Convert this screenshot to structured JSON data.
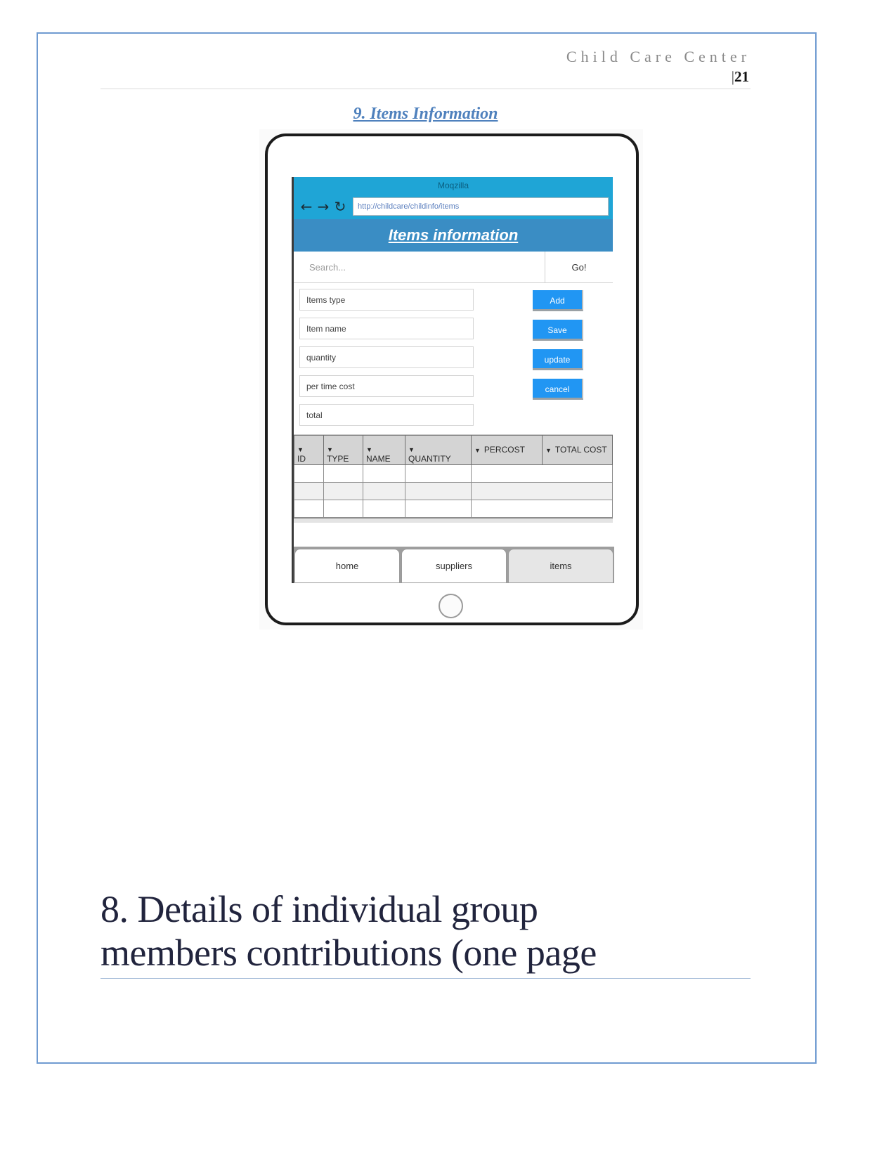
{
  "document": {
    "header_title": "Child Care Center",
    "page_number_bar": "|",
    "page_number": "21",
    "figure_caption": "9. Items Information",
    "section_heading_line1": "8. Details of individual group",
    "section_heading_line2": "members contributions (one page"
  },
  "browser": {
    "window_title": "Moqzilla",
    "back_icon": "←",
    "forward_icon": "→",
    "reload_icon": "↻",
    "url": "http://childcare/childinfo/items"
  },
  "app": {
    "title": "Items information",
    "search": {
      "placeholder": "Search...",
      "go_label": "Go!"
    },
    "form": {
      "fields": [
        {
          "label": "Items type"
        },
        {
          "label": "Item name"
        },
        {
          "label": "quantity"
        },
        {
          "label": "per time cost"
        },
        {
          "label": "total"
        }
      ],
      "buttons": [
        {
          "label": "Add"
        },
        {
          "label": "Save"
        },
        {
          "label": "update"
        },
        {
          "label": "cancel"
        }
      ]
    },
    "table": {
      "caret": "▼",
      "columns": [
        {
          "label": "ID",
          "caret_style": "stack"
        },
        {
          "label": "TYPE",
          "caret_style": "stack"
        },
        {
          "label": "NAME",
          "caret_style": "stack"
        },
        {
          "label": "QUANTITY",
          "caret_style": "stack"
        },
        {
          "label": "PERCOST",
          "caret_style": "inline"
        },
        {
          "label": "TOTAL COST",
          "caret_style": "inline"
        }
      ],
      "rows": [
        [
          "",
          "",
          "",
          "",
          "",
          ""
        ],
        [
          "",
          "",
          "",
          "",
          "",
          ""
        ],
        [
          "",
          "",
          "",
          "",
          "",
          ""
        ]
      ]
    },
    "tabs": [
      {
        "label": "home",
        "active": false
      },
      {
        "label": "suppliers",
        "active": false
      },
      {
        "label": "items",
        "active": true
      }
    ]
  },
  "colors": {
    "accent_blue": "#2196f3",
    "header_blue": "#3a8dc4",
    "chrome_blue": "#1fa5d6",
    "caption_blue": "#4f81bd",
    "heading_navy": "#21243d",
    "page_border": "#6f9bd1"
  }
}
